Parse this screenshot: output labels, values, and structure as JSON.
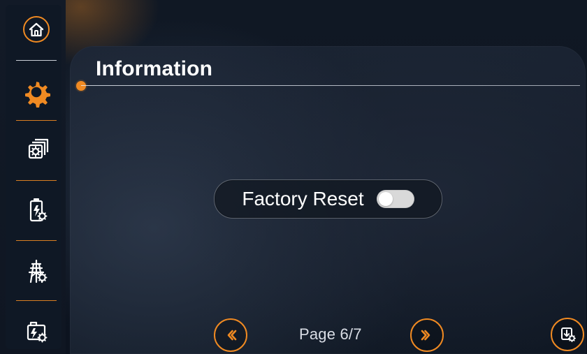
{
  "colors": {
    "accent": "#f08a22",
    "text": "#ffffff",
    "muted_text": "#d9dde5",
    "toggle_off_bg": "#d9d9d9"
  },
  "sidebar": {
    "items": [
      {
        "name": "home",
        "icon": "home-icon"
      },
      {
        "name": "settings",
        "icon": "gear-icon",
        "active": true
      },
      {
        "name": "parallel-settings",
        "icon": "stack-gear-icon"
      },
      {
        "name": "battery-settings",
        "icon": "battery-gear-icon"
      },
      {
        "name": "grid-settings",
        "icon": "tower-gear-icon"
      },
      {
        "name": "generator-settings",
        "icon": "generator-gear-icon"
      }
    ]
  },
  "main": {
    "title": "Information",
    "factory_reset": {
      "label": "Factory Reset",
      "enabled": false
    },
    "pager": {
      "text": "Page 6/7",
      "prev_icon": "double-chevron-left-icon",
      "next_icon": "double-chevron-right-icon"
    },
    "corner_action_icon": "download-gear-icon"
  }
}
